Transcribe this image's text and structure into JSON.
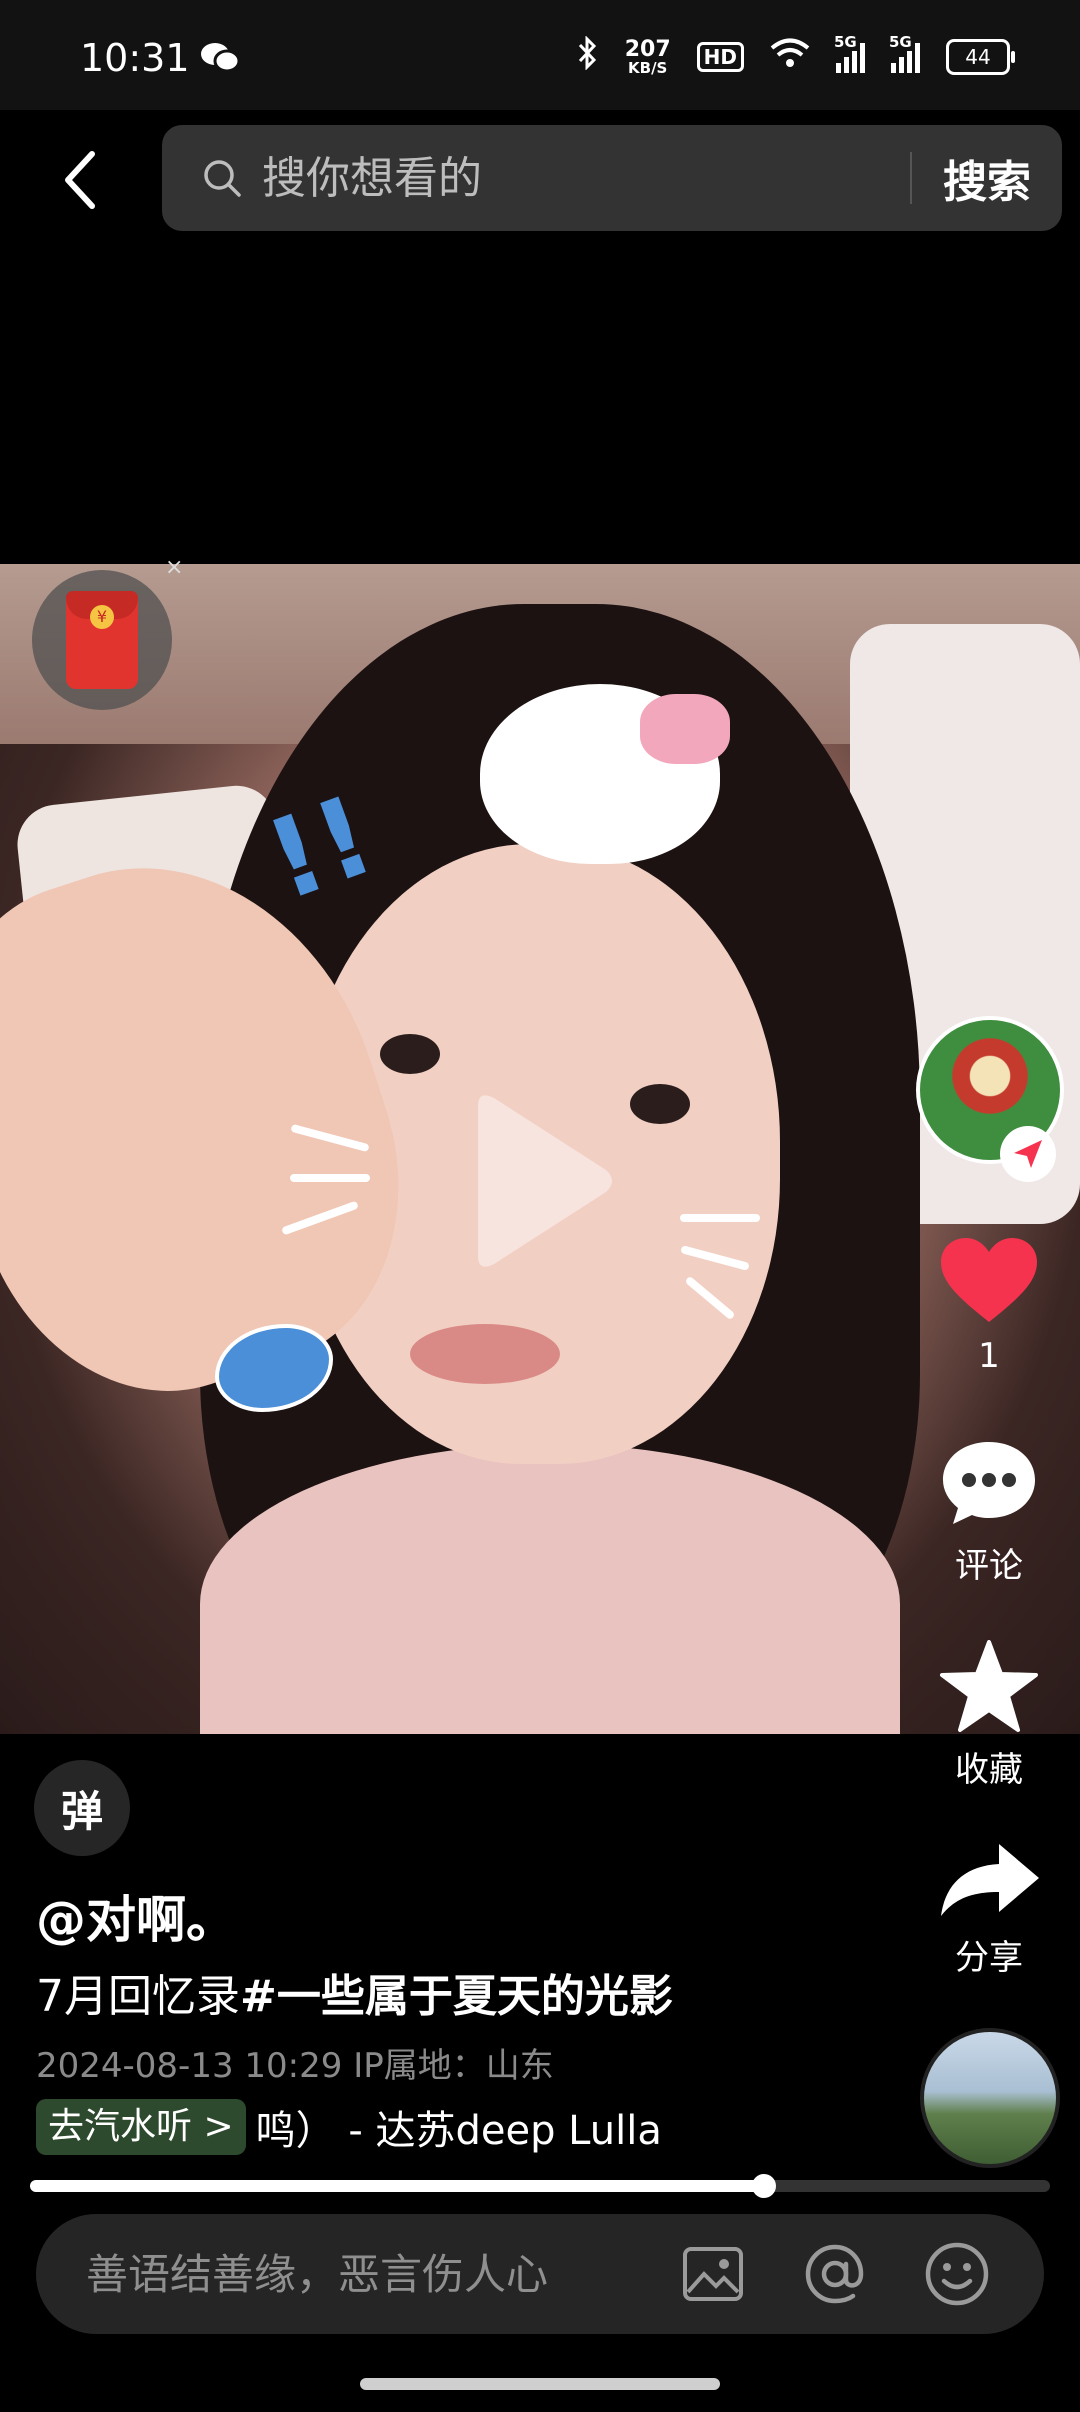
{
  "status_bar": {
    "time": "10:31",
    "net_speed_value": "207",
    "net_speed_unit": "KB/S",
    "hd_badge": "HD",
    "signal_1_label": "5G",
    "signal_2_label": "5G",
    "battery_level": "44"
  },
  "search": {
    "placeholder": "搜你想看的",
    "button_label": "搜索"
  },
  "red_packet": {
    "close_glyph": "×",
    "coin_glyph": "¥"
  },
  "video": {
    "playback_progress": 0.72
  },
  "right_rail": {
    "like_count": "1",
    "comment_label": "评论",
    "favorite_label": "收藏",
    "share_label": "分享"
  },
  "post": {
    "danmu_label": "弹",
    "author": "@对啊。",
    "caption_plain": "7月回忆录",
    "caption_tag": "#一些属于夏天的光影",
    "meta": "2024-08-13 10:29  IP属地：山东",
    "music_button": "去汽水听 >",
    "music_text": "鸣）  - 达苏deep    Lulla"
  },
  "comment_bar": {
    "placeholder": "善语结善缘，恶言伤人心"
  },
  "colors": {
    "like_red": "#f5334f",
    "music_button_bg": "#2e4a2e",
    "background": "#000000"
  }
}
